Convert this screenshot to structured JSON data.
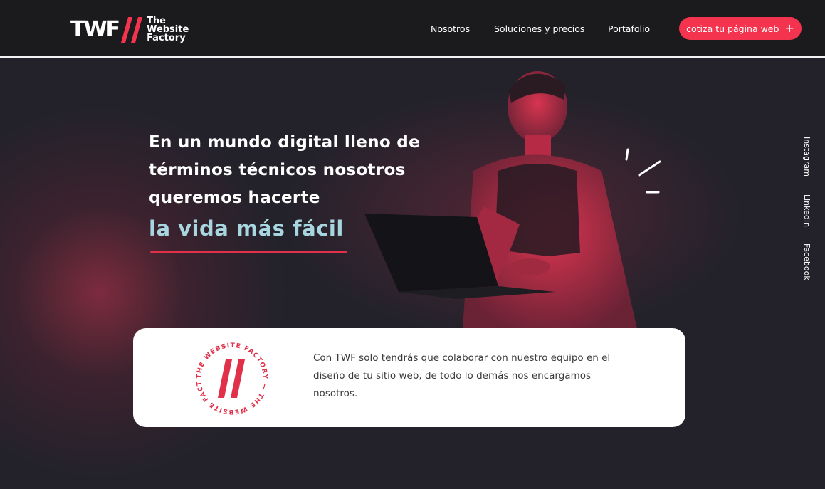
{
  "brand": {
    "logo_text": "TWF",
    "logo_line1": "The",
    "logo_line2": "Website",
    "logo_line3": "Factory",
    "accent": "#f4344f",
    "highlight_color": "#a7d6e0"
  },
  "nav": {
    "items": [
      "Nosotros",
      "Soluciones y precios",
      "Portafolio"
    ],
    "cta_label": "cotiza tu página web",
    "cta_icon": "plus-icon"
  },
  "hero": {
    "headline": "En un mundo digital lleno de términos técnicos nosotros queremos hacerte",
    "highlight": "la vida más fácil"
  },
  "social": [
    "Instagram",
    "LinkedIn",
    "Facebook"
  ],
  "card": {
    "badge_text": "THE WEBSITE FACTORY — THE WEBSITE FACTORY —",
    "text": "Con TWF solo tendrás que colaborar con nuestro equipo en el diseño de tu sitio web, de todo lo demás nos encargamos nosotros."
  }
}
